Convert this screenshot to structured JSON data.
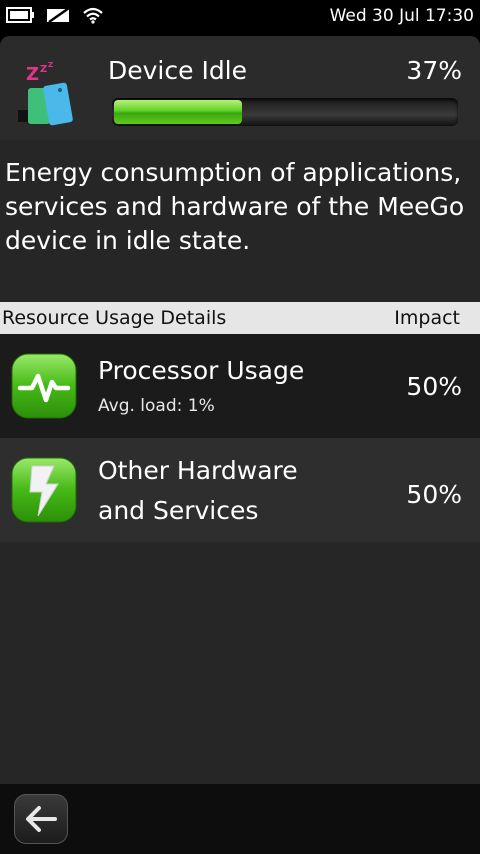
{
  "status_bar": {
    "time": "Wed 30 Jul 17:30",
    "icons": [
      "battery-icon",
      "signal-off-icon",
      "wifi-icon"
    ]
  },
  "header": {
    "icon": "device-idle-icon",
    "title": "Device Idle",
    "percent": "37%",
    "progress": 0.37
  },
  "description": "Energy consumption of applications, services and hardware of the MeeGo device in idle state.",
  "section": {
    "left_label": "Resource Usage Details",
    "right_label": "Impact"
  },
  "items": [
    {
      "icon": "processor-pulse-icon",
      "title": "Processor Usage",
      "subtitle": "Avg. load: 1%",
      "value": "50%"
    },
    {
      "icon": "lightning-bolt-icon",
      "title_line1": "Other Hardware",
      "title_line2": "and Services",
      "value": "50%"
    }
  ],
  "toolbar": {
    "back_icon": "back-arrow-icon"
  },
  "colors": {
    "progress_green": "#5fd024",
    "icon_green": "#3ab012",
    "panel_bg": "#262626"
  }
}
